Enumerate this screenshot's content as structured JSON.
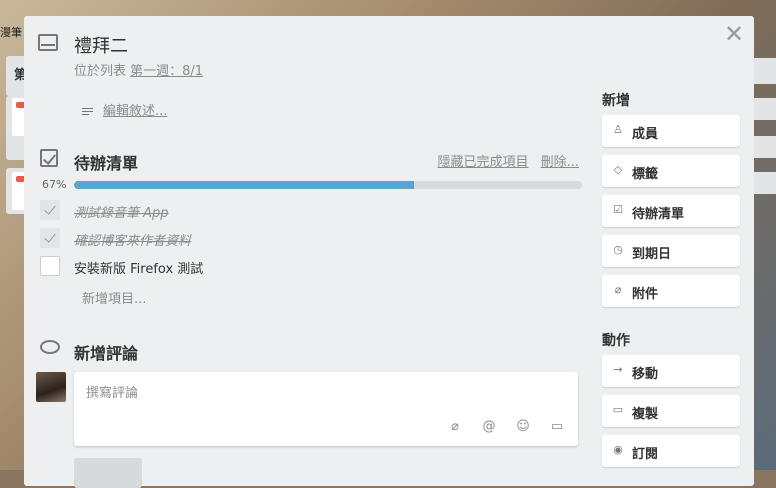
{
  "background": {
    "top_word": "漫筆",
    "list_title": "第"
  },
  "card": {
    "title": "禮拜二",
    "in_list_prefix": "位於列表",
    "list_name": "第一週：8/1",
    "edit_description": "編輯敘述..."
  },
  "checklist": {
    "title": "待辦清單",
    "hide_completed": "隱藏已完成項目",
    "delete": "刪除...",
    "percent_label": "67%",
    "progress": 0.67,
    "items": [
      {
        "text": "測試錄音筆 App",
        "checked": true
      },
      {
        "text": "確認博客來作者資料",
        "checked": true
      },
      {
        "text": "安裝新版 Firefox 測試",
        "checked": false
      }
    ],
    "add_item": "新增項目..."
  },
  "comment": {
    "title": "新增評論",
    "placeholder": "撰寫評論"
  },
  "sidebar": {
    "add_heading": "新增",
    "add_buttons": [
      {
        "label": "成員",
        "icon": "person-icon"
      },
      {
        "label": "標籤",
        "icon": "tag-icon"
      },
      {
        "label": "待辦清單",
        "icon": "checklist-icon"
      },
      {
        "label": "到期日",
        "icon": "clock-icon"
      },
      {
        "label": "附件",
        "icon": "paperclip-icon"
      }
    ],
    "actions_heading": "動作",
    "action_buttons": [
      {
        "label": "移動",
        "icon": "arrow-right-icon"
      },
      {
        "label": "複製",
        "icon": "card-icon"
      },
      {
        "label": "訂閱",
        "icon": "eye-icon"
      }
    ]
  },
  "colors": {
    "progress_fill": "#5ba4cf",
    "progress_track": "#d6dadc",
    "modal_bg": "#edeff0"
  }
}
